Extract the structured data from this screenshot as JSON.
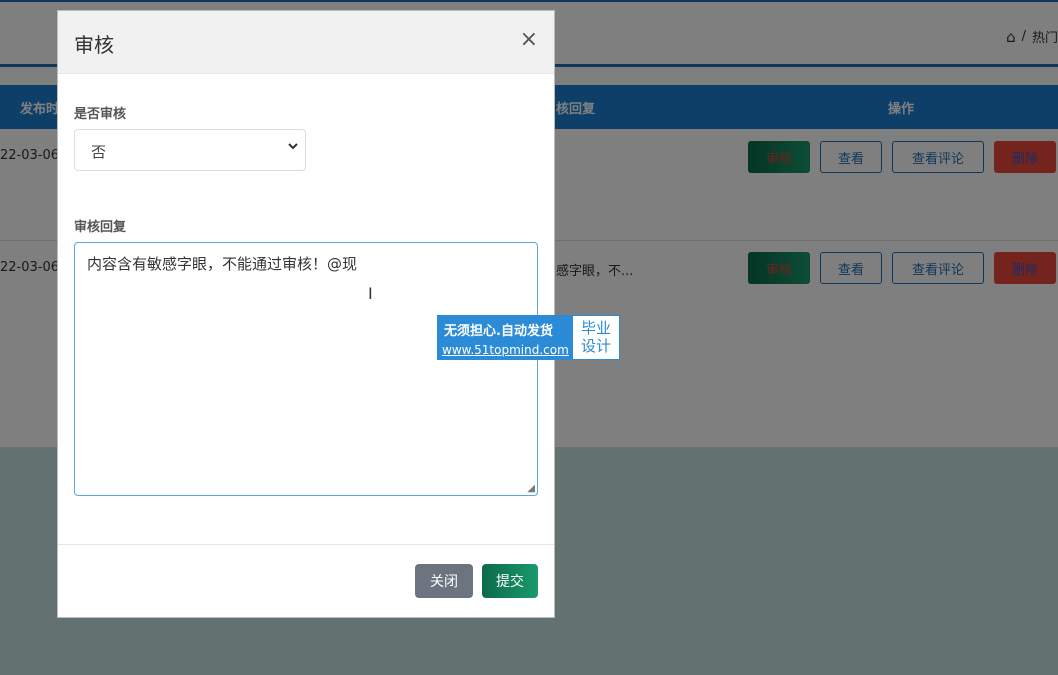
{
  "background": {
    "breadcrumb": {
      "home_icon": "home-icon",
      "separator": "/",
      "current": "热门"
    },
    "table": {
      "headers": {
        "publish_time": "发布时",
        "audit_reply": "核回复",
        "actions": "操作"
      },
      "rows": [
        {
          "date": "22-03-06",
          "audit_reply": ""
        },
        {
          "date": "22-03-06",
          "audit_reply": "感字眼，不..."
        }
      ],
      "actions": {
        "audit": "审核",
        "view": "查看",
        "view_comments": "查看评论",
        "delete": "删除"
      }
    },
    "colors": {
      "primary": "#1b7ed1",
      "success": "#0b6a4a",
      "danger": "#e8483a"
    }
  },
  "modal": {
    "title": "审核",
    "close_icon": "close-icon",
    "fields": {
      "audit_status": {
        "label": "是否审核",
        "value": "否",
        "options": [
          "否"
        ]
      },
      "audit_reply": {
        "label": "审核回复",
        "value": "内容含有敏感字眼，不能通过审核！@现"
      }
    },
    "buttons": {
      "close": "关闭",
      "submit": "提交"
    }
  },
  "watermark": {
    "line1": "无须担心.自动发货",
    "line2": "www.51topmind.com",
    "badge_line1": "毕业",
    "badge_line2": "设计"
  }
}
